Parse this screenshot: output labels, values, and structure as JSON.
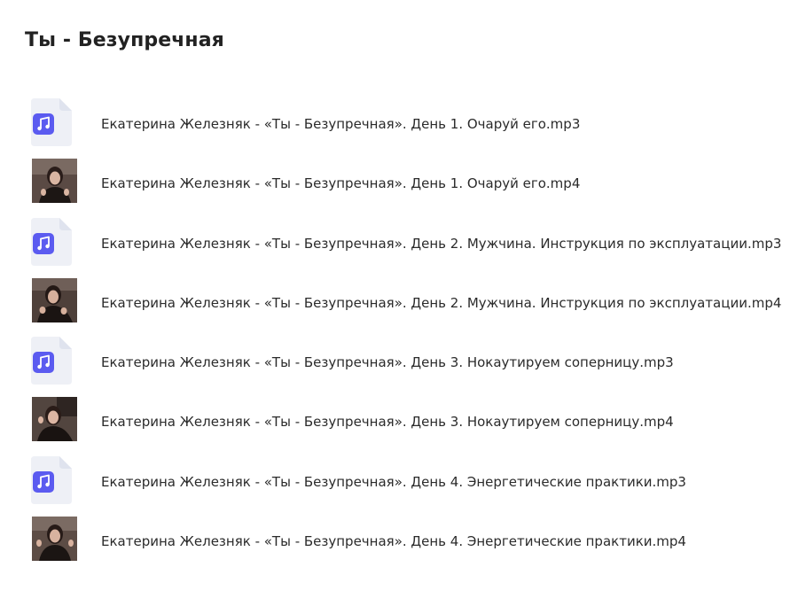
{
  "folder": {
    "title": "Ты - Безупречная"
  },
  "files": [
    {
      "name": "Екатерина Железняк - «Ты - Безупречная». День 1. Очаруй его.mp3",
      "kind": "audio",
      "icon": "music-note-icon"
    },
    {
      "name": "Екатерина Железняк - «Ты - Безупречная». День 1. Очаруй его.mp4",
      "kind": "video",
      "icon": "video-thumbnail"
    },
    {
      "name": "Екатерина Железняк - «Ты - Безупречная». День 2. Мужчина. Инструкция по эксплуатации.mp3",
      "kind": "audio",
      "icon": "music-note-icon"
    },
    {
      "name": "Екатерина Железняк - «Ты - Безупречная». День 2. Мужчина. Инструкция по эксплуатации.mp4",
      "kind": "video",
      "icon": "video-thumbnail"
    },
    {
      "name": "Екатерина Железняк - «Ты - Безупречная». День 3. Нокаутируем соперницу.mp3",
      "kind": "audio",
      "icon": "music-note-icon"
    },
    {
      "name": "Екатерина Железняк - «Ты - Безупречная». День 3. Нокаутируем соперницу.mp4",
      "kind": "video",
      "icon": "video-thumbnail"
    },
    {
      "name": "Екатерина Железняк - «Ты - Безупречная». День 4. Энергетические практики.mp3",
      "kind": "audio",
      "icon": "music-note-icon"
    },
    {
      "name": "Екатерина Железняк - «Ты - Безупречная». День 4. Энергетические практики.mp4",
      "kind": "video",
      "icon": "video-thumbnail"
    }
  ],
  "colors": {
    "audio_badge": "#5b5bf0",
    "file_sheet": "#eef0f6",
    "file_fold": "#dfe3ee"
  }
}
